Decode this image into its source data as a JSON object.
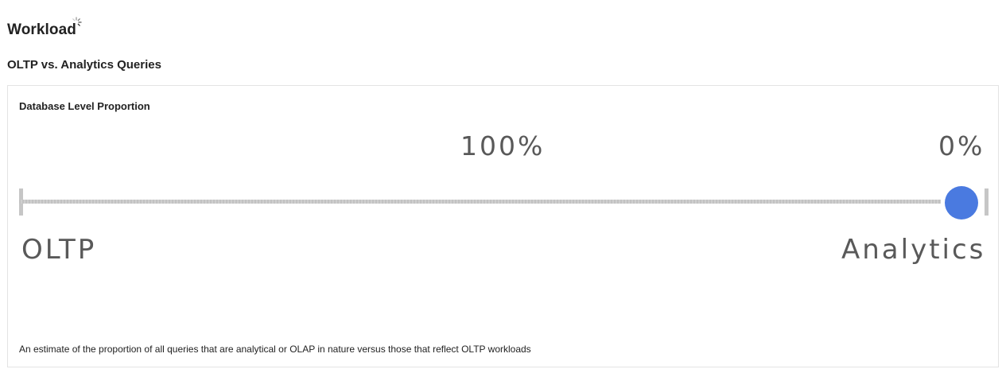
{
  "page": {
    "title": "Workload",
    "section_title": "OLTP vs. Analytics Queries"
  },
  "card": {
    "title": "Database Level Proportion",
    "left_percent": "100%",
    "right_percent": "0%",
    "left_label": "OLTP",
    "right_label": "Analytics",
    "footnote": "An estimate of the proportion of all queries that are analytical or OLAP in nature versus those that reflect OLTP workloads"
  },
  "slider": {
    "analytics_fraction": 1.0,
    "thumb_color": "#4a7ae0",
    "track_color": "#c6c6c6"
  },
  "icons": {
    "loading": "loading-spinner-icon"
  }
}
